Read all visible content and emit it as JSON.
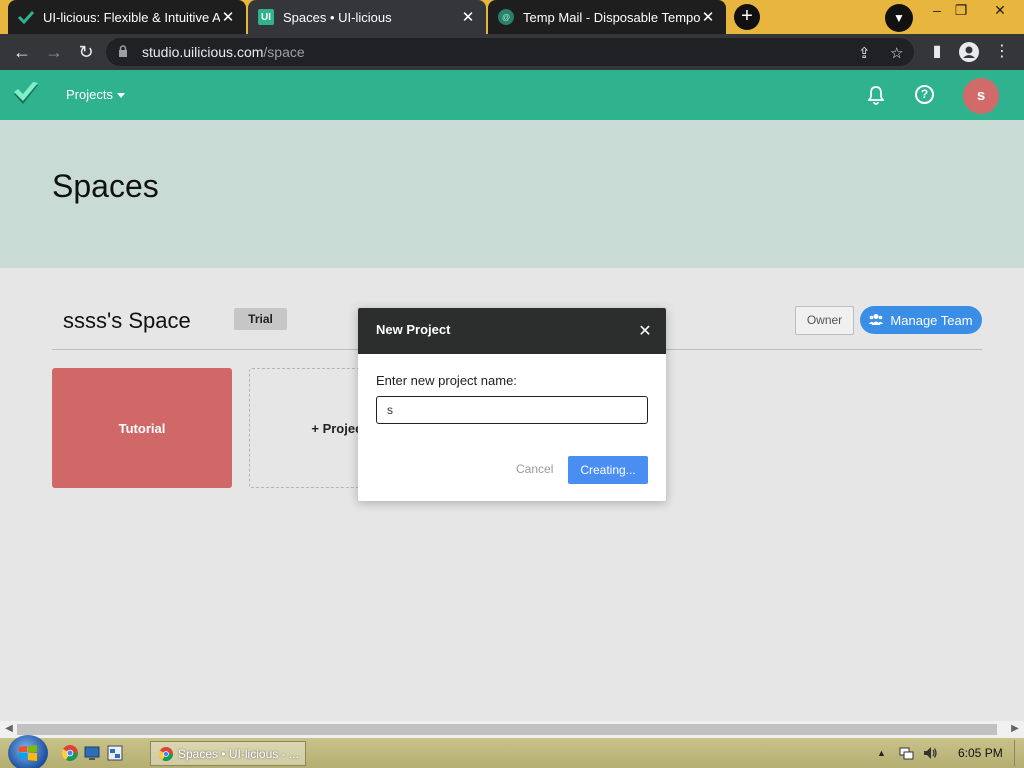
{
  "browser": {
    "tabs": [
      {
        "title": "UI-licious: Flexible & Intuitive Aut",
        "close": "✕"
      },
      {
        "title": "Spaces • UI-licious",
        "close": "✕"
      },
      {
        "title": "Temp Mail - Disposable Tempora",
        "close": "✕"
      }
    ],
    "new_tab_label": "+",
    "url_host": "studio.uilicious.com",
    "url_path": "/space",
    "window_controls": {
      "minimize": "–",
      "restore": "❐",
      "close": "✕"
    }
  },
  "app": {
    "projects_menu_label": "Projects",
    "avatar_initial": "s",
    "help_label": "?",
    "accent_color": "#2fb38f"
  },
  "hero": {
    "title": "Spaces"
  },
  "space": {
    "name": "ssss's Space",
    "plan_badge": "Trial",
    "owner_button": "Owner",
    "manage_team_button": "Manage Team",
    "projects": [
      {
        "name": "Tutorial"
      }
    ],
    "add_project_label": "+ Project"
  },
  "modal": {
    "title": "New Project",
    "close": "✕",
    "label": "Enter new project name:",
    "input_value": "s",
    "cancel_label": "Cancel",
    "create_label": "Creating..."
  },
  "taskbar": {
    "active_window": "Spaces • UI-licious - ...",
    "clock": "6:05 PM"
  }
}
